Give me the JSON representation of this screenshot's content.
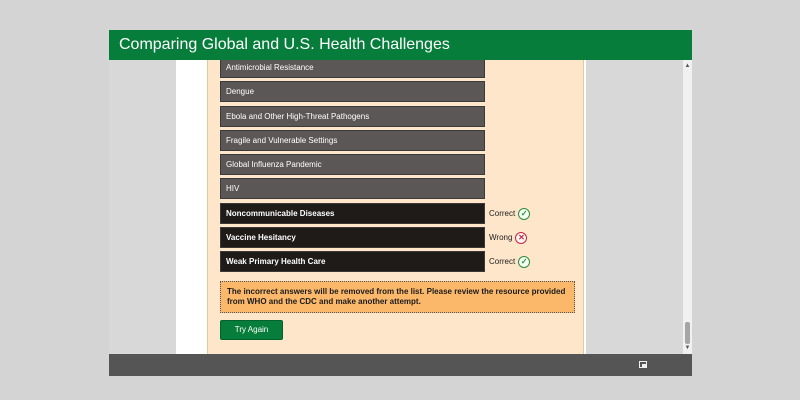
{
  "window": {
    "title": "Comparing Global and U.S. Health Challenges"
  },
  "list": {
    "items": [
      {
        "label": "Antimicrobial Resistance",
        "style": "grey"
      },
      {
        "label": "Dengue",
        "style": "grey"
      },
      {
        "label": "Ebola and Other High-Threat Pathogens",
        "style": "grey"
      },
      {
        "label": "Fragile and Vulnerable Settings",
        "style": "grey"
      },
      {
        "label": "Global Influenza Pandemic",
        "style": "grey"
      },
      {
        "label": "HIV",
        "style": "grey"
      },
      {
        "label": "Noncommunicable Diseases",
        "style": "black",
        "feedback": "Correct",
        "feedback_icon": "check-circle-icon"
      },
      {
        "label": "Vaccine Hesitancy",
        "style": "black",
        "feedback": "Wrong",
        "feedback_icon": "x-circle-icon"
      },
      {
        "label": "Weak Primary Health Care",
        "style": "black",
        "feedback": "Correct",
        "feedback_icon": "check-circle-icon"
      }
    ]
  },
  "message": {
    "text": "The incorrect answers will be removed from the list. Please review the resource provided from WHO and the CDC and make another attempt."
  },
  "buttons": {
    "try_again": "Try Again"
  },
  "colors": {
    "title_bar": "#067d3a",
    "panel": "#fde6c9",
    "grey_item": "#5c5757",
    "black_item": "#1e1b18",
    "message": "#fbb86a",
    "correct": "#2f8a39",
    "wrong": "#c5283b"
  }
}
